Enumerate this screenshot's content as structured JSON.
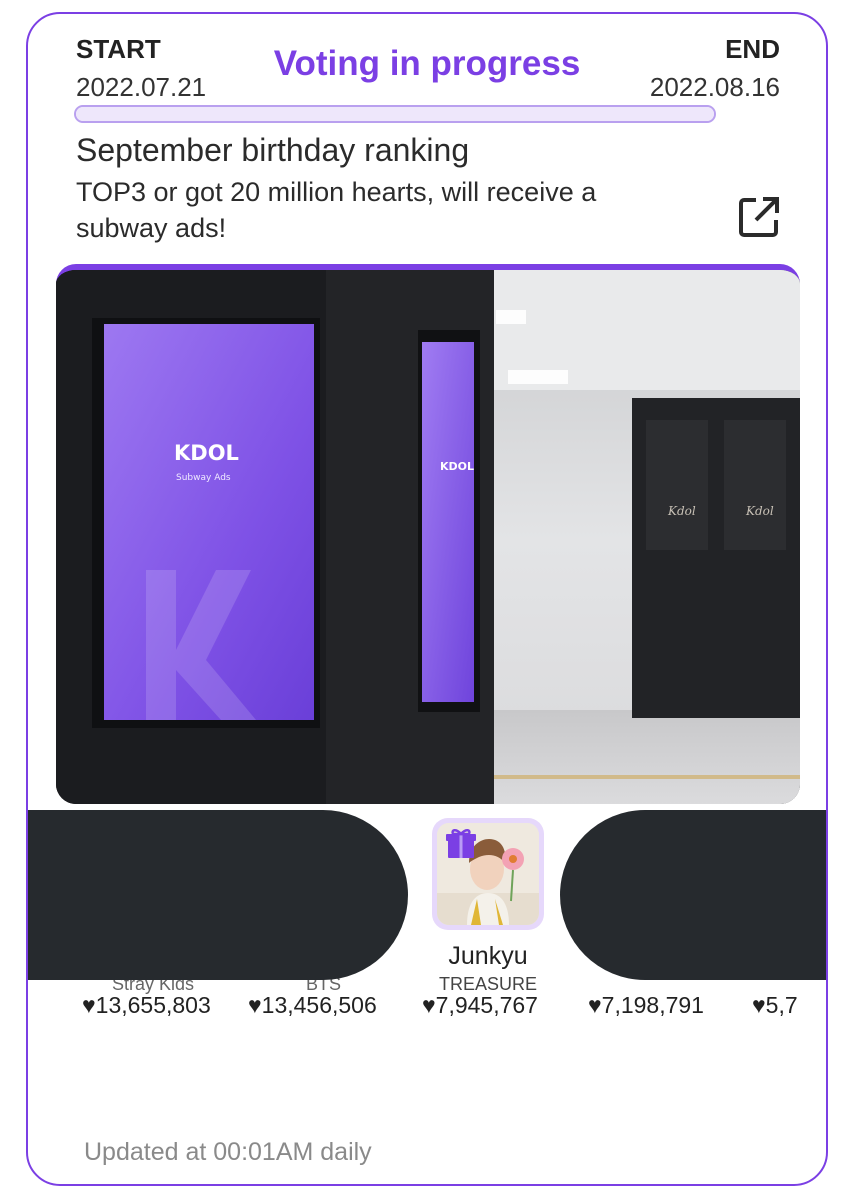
{
  "header": {
    "start_label": "START",
    "start_date": "2022.07.21",
    "end_label": "END",
    "end_date": "2022.08.16",
    "status": "Voting in progress",
    "progress": 1.0
  },
  "event": {
    "title": "September birthday ranking",
    "description": "TOP3 or got 20 million hearts, will receive a subway ads!",
    "share_icon": "open-in-new-icon"
  },
  "banner": {
    "brand": "KDOL",
    "subtitle": "Subway Ads",
    "side_brand": "KDOL",
    "letter": "K",
    "poster_text": "Kdol"
  },
  "ranking": [
    {
      "name": "",
      "group": "Stray Kids",
      "hearts": "♥13,655,803"
    },
    {
      "name": "",
      "group": "BTS",
      "hearts": "♥13,456,506"
    },
    {
      "name": "Junkyu",
      "group": "TREASURE",
      "hearts": "♥7,945,767",
      "badge": "gift-icon"
    },
    {
      "name": "",
      "group": "",
      "hearts": "♥7,198,791"
    },
    {
      "name": "",
      "group": "",
      "hearts": "♥5,7"
    }
  ],
  "footer": {
    "updated": "Updated at 00:01AM daily"
  },
  "colors": {
    "accent": "#7b3fe4",
    "redaction": "#262a2e"
  }
}
